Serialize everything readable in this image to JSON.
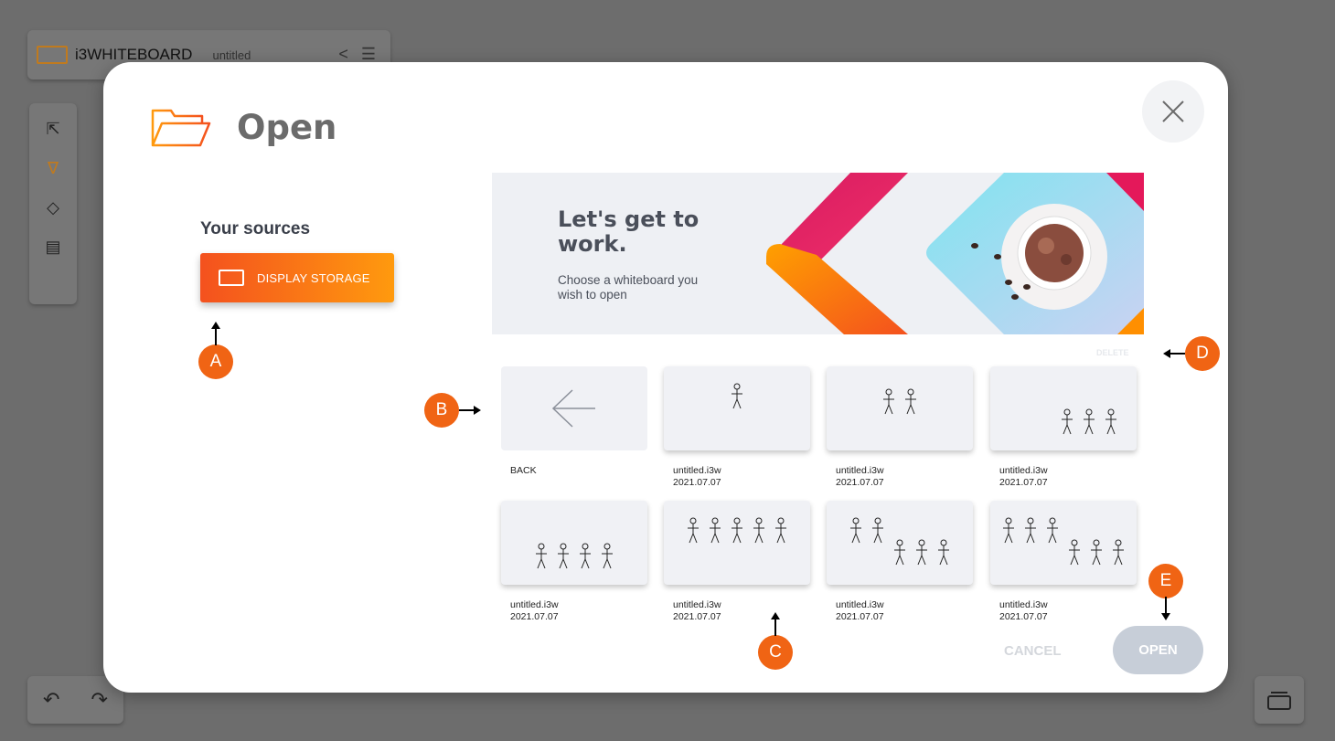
{
  "app": {
    "name": "i3WHITEBOARD",
    "document": "untitled"
  },
  "dialog": {
    "title": "Open",
    "sources_title": "Your sources",
    "storage_button": "DISPLAY STORAGE",
    "banner": {
      "heading": "Let's get to work.",
      "text": "Choose a whiteboard you wish to open"
    },
    "delete_label": "DELETE",
    "back_label": "BACK",
    "files": [
      {
        "name": "untitled.i3w",
        "date": "2021.07.07",
        "figures": 1
      },
      {
        "name": "untitled.i3w",
        "date": "2021.07.07",
        "figures": 2
      },
      {
        "name": "untitled.i3w",
        "date": "2021.07.07",
        "figures": 3
      },
      {
        "name": "untitled.i3w",
        "date": "2021.07.07",
        "figures": 4
      },
      {
        "name": "untitled.i3w",
        "date": "2021.07.07",
        "figures": 5
      },
      {
        "name": "untitled.i3w",
        "date": "2021.07.07",
        "figures": 5
      },
      {
        "name": "untitled.i3w",
        "date": "2021.07.07",
        "figures": 6
      }
    ],
    "cancel_label": "CANCEL",
    "open_label": "OPEN"
  },
  "markers": [
    "A",
    "B",
    "C",
    "D",
    "E"
  ],
  "colors": {
    "accent_start": "#f4511e",
    "accent_end": "#ff9a0e",
    "marker": "#f06414",
    "open_disabled": "#c7ced8"
  }
}
